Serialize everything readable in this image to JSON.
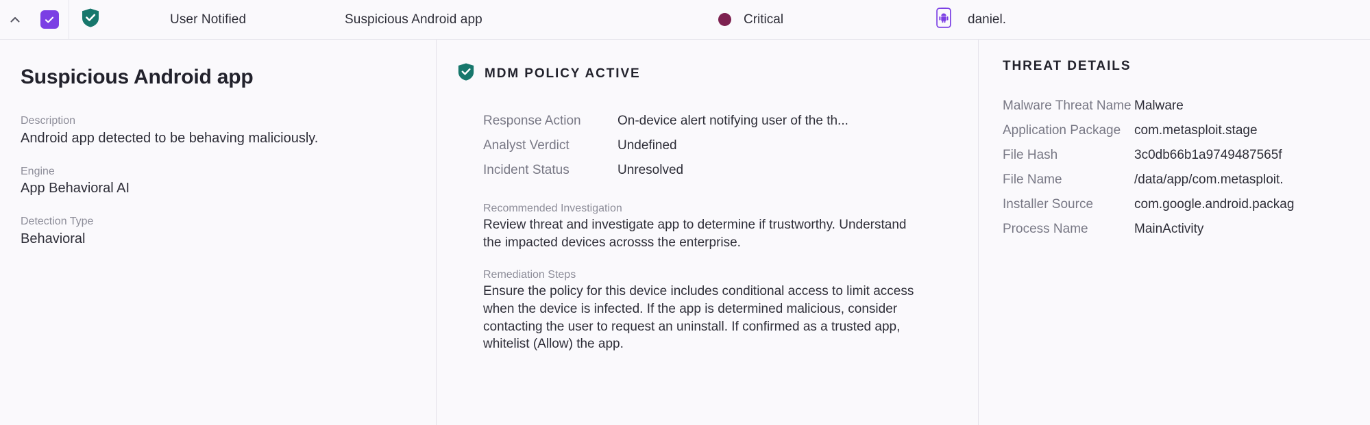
{
  "topbar": {
    "collapse_icon": "chevron-up-icon",
    "checkbox_checked": true,
    "checkbox_color": "#7b3fe4",
    "shield_icon": "shield-check-icon",
    "shield_color": "#17776c",
    "status": "User Notified",
    "threat_name": "Suspicious Android app",
    "severity": "Critical",
    "severity_color": "#7d2150",
    "device_icon": "mobile-android-icon",
    "device_icon_color": "#7b3fe4",
    "user": "daniel."
  },
  "left": {
    "title": "Suspicious Android app",
    "fields": [
      {
        "label": "Description",
        "value": "Android app detected to be behaving maliciously."
      },
      {
        "label": "Engine",
        "value": "App Behavioral AI"
      },
      {
        "label": "Detection Type",
        "value": "Behavioral"
      }
    ]
  },
  "middle": {
    "section_icon": "shield-check-icon",
    "section_title": "MDM POLICY ACTIVE",
    "rows": [
      {
        "key": "Response Action",
        "value": "On-device alert notifying user of the th..."
      },
      {
        "key": "Analyst Verdict",
        "value": "Undefined"
      },
      {
        "key": "Incident Status",
        "value": "Unresolved"
      }
    ],
    "investigation_label": "Recommended Investigation",
    "investigation_text": "Review threat and investigate app to determine if trustworthy. Understand the impacted devices acrosss the enterprise.",
    "remediation_label": "Remediation Steps",
    "remediation_text": "Ensure the policy for this device includes conditional access to limit access when the device is infected. If the app is determined malicious, consider contacting the user to request an uninstall. If confirmed as a trusted app, whitelist (Allow) the app."
  },
  "right": {
    "section_title": "THREAT DETAILS",
    "rows": [
      {
        "key": "Malware Threat Name",
        "value": "Malware"
      },
      {
        "key": "Application Package",
        "value": "com.metasploit.stage"
      },
      {
        "key": "File Hash",
        "value": "3c0db66b1a9749487565f"
      },
      {
        "key": "File Name",
        "value": "/data/app/com.metasploit."
      },
      {
        "key": "Installer Source",
        "value": "com.google.android.packag"
      },
      {
        "key": "Process Name",
        "value": "MainActivity"
      }
    ]
  }
}
